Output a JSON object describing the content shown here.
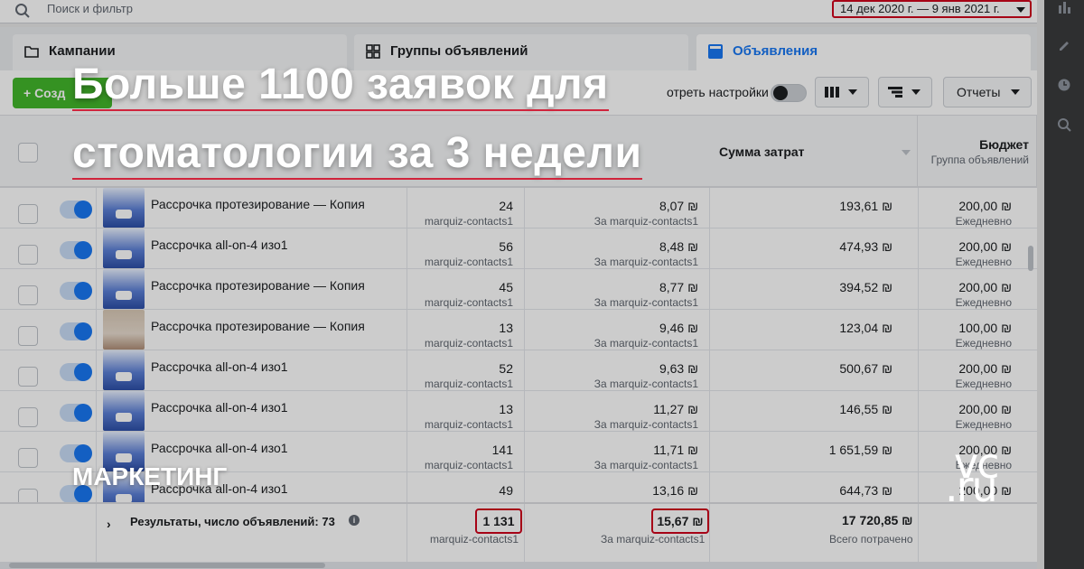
{
  "search": {
    "placeholder": "Поиск и фильтр"
  },
  "date_range": {
    "label": "14 дек 2020 г. — 9 янв 2021 г."
  },
  "tabs": [
    {
      "label": "Кампании",
      "icon": "folder-icon",
      "active": false
    },
    {
      "label": "Группы объявлений",
      "icon": "grid-icon",
      "active": false
    },
    {
      "label": "Объявления",
      "icon": "ad-icon",
      "active": true
    }
  ],
  "toolbar": {
    "create_label": "+ Созд",
    "settings_label": "отреть настройки",
    "reports_label": "Отчеты"
  },
  "table": {
    "columns": [
      {
        "label": "Сумма затрат"
      },
      {
        "label": "Бюджет",
        "sub": "Группа объявлений"
      }
    ],
    "rows": [
      {
        "name": "Рассрочка протезирование — Копия",
        "results": "24",
        "results_sub": "marquiz-contacts1",
        "cost": "8,07 ₪",
        "cost_sub": "За marquiz-contacts1",
        "spend": "193,61 ₪",
        "budget": "200,00 ₪",
        "budget_sub": "Ежедневно",
        "thumb": "blue"
      },
      {
        "name": "Рассрочка all-on-4 изо1",
        "results": "56",
        "results_sub": "marquiz-contacts1",
        "cost": "8,48 ₪",
        "cost_sub": "За marquiz-contacts1",
        "spend": "474,93 ₪",
        "budget": "200,00 ₪",
        "budget_sub": "Ежедневно",
        "thumb": "blue"
      },
      {
        "name": "Рассрочка протезирование — Копия",
        "results": "45",
        "results_sub": "marquiz-contacts1",
        "cost": "8,77 ₪",
        "cost_sub": "За marquiz-contacts1",
        "spend": "394,52 ₪",
        "budget": "200,00 ₪",
        "budget_sub": "Ежедневно",
        "thumb": "blue"
      },
      {
        "name": "Рассрочка протезирование — Копия",
        "results": "13",
        "results_sub": "marquiz-contacts1",
        "cost": "9,46 ₪",
        "cost_sub": "За marquiz-contacts1",
        "spend": "123,04 ₪",
        "budget": "100,00 ₪",
        "budget_sub": "Ежедневно",
        "thumb": "photo"
      },
      {
        "name": "Рассрочка all-on-4 изо1",
        "results": "52",
        "results_sub": "marquiz-contacts1",
        "cost": "9,63 ₪",
        "cost_sub": "За marquiz-contacts1",
        "spend": "500,67 ₪",
        "budget": "200,00 ₪",
        "budget_sub": "Ежедневно",
        "thumb": "blue"
      },
      {
        "name": "Рассрочка all-on-4 изо1",
        "results": "13",
        "results_sub": "marquiz-contacts1",
        "cost": "11,27 ₪",
        "cost_sub": "За marquiz-contacts1",
        "spend": "146,55 ₪",
        "budget": "200,00 ₪",
        "budget_sub": "Ежедневно",
        "thumb": "blue"
      },
      {
        "name": "Рассрочка all-on-4 изо1",
        "results": "141",
        "results_sub": "marquiz-contacts1",
        "cost": "11,71 ₪",
        "cost_sub": "За marquiz-contacts1",
        "spend": "1 651,59 ₪",
        "budget": "200,00 ₪",
        "budget_sub": "Ежедневно",
        "thumb": "blue"
      },
      {
        "name": "Рассрочка all-on-4 изо1",
        "results": "49",
        "results_sub": "",
        "cost": "13,16 ₪",
        "cost_sub": "",
        "spend": "644,73 ₪",
        "budget": "200,00 ₪",
        "budget_sub": "",
        "thumb": "blue"
      }
    ],
    "footer": {
      "label": "Результаты, число объявлений: 73",
      "results_total": "1 131",
      "results_sub": "marquiz-contacts1",
      "cost_total": "15,67 ₪",
      "cost_sub": "За marquiz-contacts1",
      "spend_total": "17 720,85 ₪",
      "spend_sub": "Всего потрачено"
    }
  },
  "overlay": {
    "headline_line1": "Больше 1100 заявок для",
    "headline_line2": "стоматологии за 3 недели",
    "category": "МАРКЕТИНГ",
    "logo_top": "vc",
    "logo_bottom": ".ru"
  },
  "colors": {
    "accent_blue": "#1877f2",
    "highlight_red": "#d0021b",
    "create_green": "#42b72a",
    "underline_red": "#d0243c"
  }
}
